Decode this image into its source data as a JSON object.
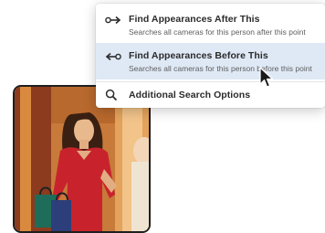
{
  "menu": {
    "items": [
      {
        "icon": "arrow-right-dot-icon",
        "title": "Find Appearances After This",
        "subtitle": "Searches all cameras for this person after this point"
      },
      {
        "icon": "arrow-left-dot-icon",
        "title": "Find Appearances Before This",
        "subtitle": "Searches all cameras for this person before this point"
      },
      {
        "icon": "search-icon",
        "title": "Additional Search Options"
      }
    ],
    "hover_color": "#dfe9f6"
  },
  "thumbnail": {
    "description_icon": "person-photo",
    "accent_color": "#c8232c"
  }
}
